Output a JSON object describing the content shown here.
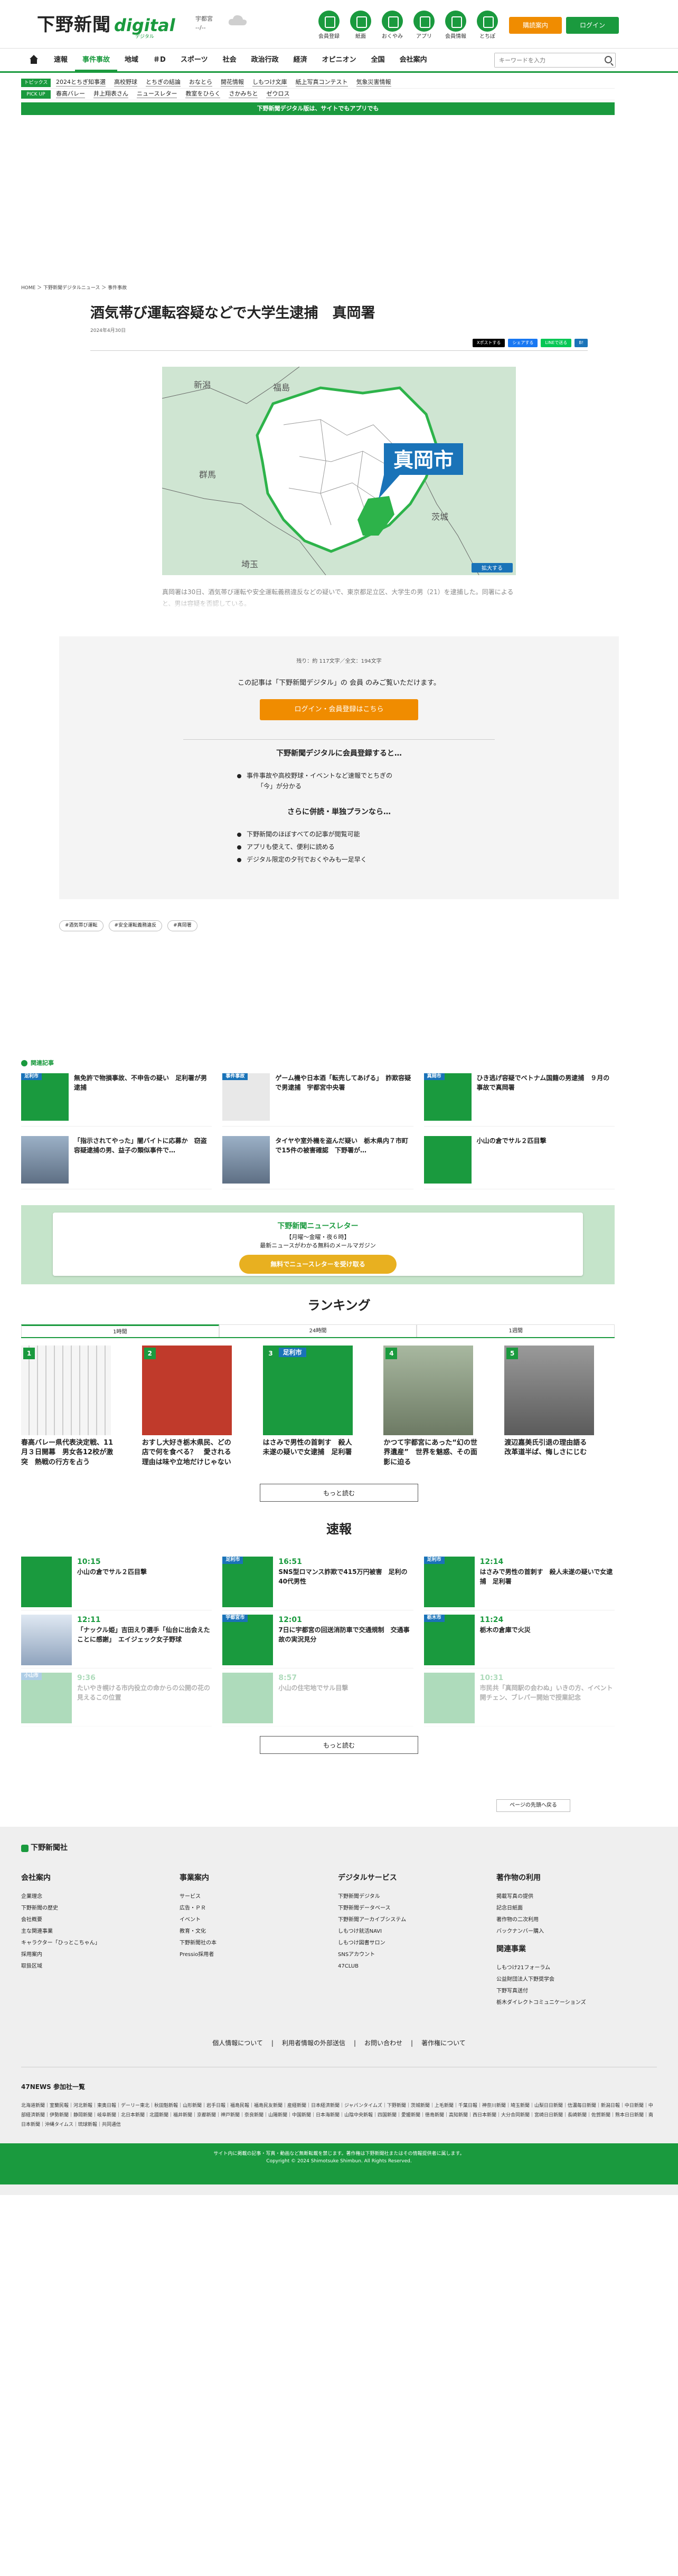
{
  "header": {
    "logo_jp": "下野新聞",
    "logo_digital": "digital",
    "logo_sub": "デジタル",
    "weather_city": "宇都宮",
    "weather_temp": "--/--",
    "icons": [
      {
        "label": "会員登録",
        "icon": "member-icon"
      },
      {
        "label": "紙面",
        "icon": "paper-icon"
      },
      {
        "label": "おくやみ",
        "icon": "condolence-icon"
      },
      {
        "label": "アプリ",
        "icon": "app-icon"
      },
      {
        "label": "会員情報",
        "icon": "account-icon"
      },
      {
        "label": "とちぽ",
        "icon": "tochipo-icon"
      }
    ],
    "subscribe": "購読案内",
    "login": "ログイン"
  },
  "nav": {
    "items": [
      "速報",
      "事件事故",
      "地域",
      "＃D",
      "スポーツ",
      "社会",
      "政治行政",
      "経済",
      "オピニオン",
      "全国",
      "会社案内"
    ],
    "active": "事件事故",
    "search_placeholder": "キーワードを入力"
  },
  "topics": [
    {
      "tag": "トピックス",
      "items": [
        "2024とちぎ知事選",
        "高校野球",
        "とちぎの結論",
        "おなとら",
        "開花情報",
        "しもつけ文庫",
        "紙上写真コンテスト",
        "気象災害情報"
      ]
    },
    {
      "tag": "PICK UP",
      "items": [
        "春高バレー",
        "井上翔表さん",
        "ニュースレター",
        "教室をひらく",
        "さかみちと",
        "ゼウロス"
      ]
    }
  ],
  "appbar": "下野新聞デジタル版は、サイトでもアプリでも",
  "breadcrumb": "HOME ＞ 下野新聞デジタルニュース ＞ 事件事故",
  "article": {
    "title": "酒気帯び運転容疑などで大学生逮捕　真岡署",
    "date": "2024年4月30日",
    "share": [
      "Xポストする",
      "シェアする",
      "LINEで送る",
      "B!"
    ],
    "map": {
      "labels": [
        "新潟",
        "福島",
        "群馬",
        "茨城",
        "埼玉"
      ],
      "highlight": "真岡市",
      "badge": "拡大する"
    },
    "lede": "真岡署は30日、酒気帯び運転や安全運転義務違反などの疑いで、東京都足立区、大学生の男（21）を逮捕した。同署によると、男は容疑を否認している。"
  },
  "paywall": {
    "count": "残り：約 117文字／全文：194文字",
    "msg": "この記事は「下野新聞デジタル」の 会員 のみご覧いただけます。",
    "btn": "ログイン・会員登録はこちら",
    "h1": "下野新聞デジタルに会員登録すると…",
    "list1": [
      "事件事故や高校野球・イベントなど速報でとちぎの"
    ],
    "plain1": "「今」が分かる",
    "h2": "さらに併読・単独プランなら…",
    "list2": [
      "下野新聞のほぼすべての記事が閲覧可能",
      "アプリも使えて、便利に読める",
      "デジタル限定の夕刊でおくやみも一足早く"
    ]
  },
  "tags": [
    "#酒気帯び運転",
    "#安全運転義務違反",
    "#真岡署"
  ],
  "related": {
    "heading": "関連記事",
    "items": [
      {
        "title": "無免許で物損事故、不申告の疑い　足利署が男逮捕",
        "label": "足利市",
        "thumb": "green"
      },
      {
        "title": "ゲーム機や日本酒「転売してあげる」　詐欺容疑で男逮捕　宇都宮中央署",
        "label": "事件事故",
        "thumb": "gray"
      },
      {
        "title": "ひき逃げ容疑でベトナム国籍の男逮捕　９月の事故で真岡署",
        "label": "真岡市",
        "thumb": "green"
      },
      {
        "title": "「指示されてやった」闇バイトに応募か　窃盗容疑逮捕の男、益子の類似事件で…",
        "label": "",
        "thumb": "photo"
      },
      {
        "title": "タイヤや室外機を盗んだ疑い　栃木県内７市町で15件の被害確認　下野署が…",
        "label": "",
        "thumb": "photo"
      },
      {
        "title": "小山の倉でサル２匹目撃",
        "label": "",
        "thumb": "green"
      }
    ]
  },
  "newsletter": {
    "title": "下野新聞ニュースレター",
    "sub1": "【月曜～金曜・夜６時】",
    "sub2": "最新ニュースがわかる無料のメールマガジン",
    "btn": "無料でニュースレターを受け取る"
  },
  "ranking": {
    "heading": "ランキング",
    "tabs": [
      "1時間",
      "24時間",
      "1週間"
    ],
    "active": "1時間",
    "items": [
      {
        "num": "1",
        "title": "春高バレー県代表決定戦、11月３日開幕　男女各12校が激突　熱戦の行方を占う"
      },
      {
        "num": "2",
        "title": "おすし大好き栃木県民、どの店で何を食べる？　愛される理由は味や立地だけじゃない"
      },
      {
        "num": "3",
        "title": "はさみで男性の首刺す　殺人未遂の疑いで女逮捕　足利署"
      },
      {
        "num": "4",
        "title": "かつて宇都宮にあった“幻の世界遺産”　世界を魅惑、その面影に迫る"
      },
      {
        "num": "5",
        "title": "渡辺嘉美氏引退の理由語る　改革道半ば、悔しさにじむ"
      }
    ],
    "more": "もっと読む",
    "thumb_label": "足利市"
  },
  "sokuho": {
    "heading": "速報",
    "items": [
      {
        "time": "10:15",
        "title": "小山の倉でサル２匹目撃",
        "label": ""
      },
      {
        "time": "16:51",
        "title": "SNS型ロマンス詐欺で415万円被害　足利の40代男性",
        "label": "足利市"
      },
      {
        "time": "12:14",
        "title": "はさみで男性の首刺す　殺人未遂の疑いで女逮捕　足利署",
        "label": "足利市"
      },
      {
        "time": "12:11",
        "title": "「ナックル姫」吉田えり選手「仙台に出会えたことに感謝」　エイジェック女子野球",
        "label": ""
      },
      {
        "time": "12:01",
        "title": "7日に宇都宮の回送消防車で交通規制　交通事故の実況見分",
        "label": "宇都宮市"
      },
      {
        "time": "11:24",
        "title": "栃木の倉庫で火災",
        "label": "栃木市"
      },
      {
        "time": "9:36",
        "title": "たいやき幌ける市内役立の命からの公開の花の見えるこの位置",
        "label": "小山市"
      },
      {
        "time": "8:57",
        "title": "小山の住宅地でサル目撃",
        "label": ""
      },
      {
        "time": "10:31",
        "title": "市民共「真岡駅の会わぬ」いきの方、イベント開チェン、ブレパー開始で授業記念",
        "label": ""
      }
    ],
    "more": "もっと読む"
  },
  "scrolltop": "ページの先頭へ戻る",
  "footer": {
    "logo": "下野新聞社",
    "cols": [
      {
        "h": "会社案内",
        "items": [
          "企業理念",
          "下野新聞の歴史",
          "会社概要",
          "主な関連事業",
          "キャラクター「ひっとこちゃん」",
          "採用案内",
          "取扱区域"
        ]
      },
      {
        "h": "事業案内",
        "items": [
          "サービス",
          "広告・ＰＲ",
          "イベント",
          "教育・文化",
          "下野新聞社の本",
          "Pressio採用者"
        ]
      },
      {
        "h": "デジタルサービス",
        "items": [
          "下野新聞デジタル",
          "下野新聞データベース",
          "下野新聞アーカイブシステム",
          "しもつけ就活NAVI",
          "しもつけ図書サロン",
          "SNSアカウント",
          "47CLUB"
        ]
      },
      {
        "h": "著作物の利用",
        "items": [
          "掲載写真の提供",
          "記念日紙面",
          "著作物の二次利用",
          "バックナンバー購入"
        ],
        "h2": "関連事業",
        "items2": [
          "しもつけ21フォーラム",
          "公益財団法人下野奨学会",
          "下野写真送付",
          "栃木ダイレクトコミュニケーションズ"
        ]
      }
    ],
    "links": [
      "個人情報について",
      "利用者情報の外部送信",
      "お問い合わせ",
      "著作権について"
    ],
    "news_h": "47NEWS 参加社一覧",
    "news_list": "北海道新聞｜室蘭民報｜河北新報｜東奥日報｜デーリー東北｜秋田魁新報｜山形新聞｜岩手日報｜福島民報｜福島民友新聞｜産経新聞｜日本経済新聞｜ジャパンタイムズ｜下野新聞｜茨城新聞｜上毛新聞｜千葉日報｜神奈川新聞｜埼玉新聞｜山梨日日新聞｜信濃毎日新聞｜新潟日報｜中日新聞｜中部経済新聞｜伊勢新聞｜静岡新聞｜岐阜新聞｜北日本新聞｜北國新聞｜福井新聞｜京都新聞｜神戸新聞｜奈良新聞｜山陽新聞｜中国新聞｜日本海新聞｜山陰中央新報｜四国新聞｜愛媛新聞｜徳島新聞｜高知新聞｜西日本新聞｜大分合同新聞｜宮崎日日新聞｜長崎新聞｜佐賀新聞｜熊本日日新聞｜南日本新聞｜沖縄タイムス｜琉球新報｜共同通信",
    "bottom1": "サイト内に掲載の記事・写真・動画など無断転載を禁じます。著作権は下野新聞社またはその情報提供者に属します。",
    "bottom2": "Copyright © 2024 Shimotsuke Shimbun. All Rights Reserved."
  }
}
